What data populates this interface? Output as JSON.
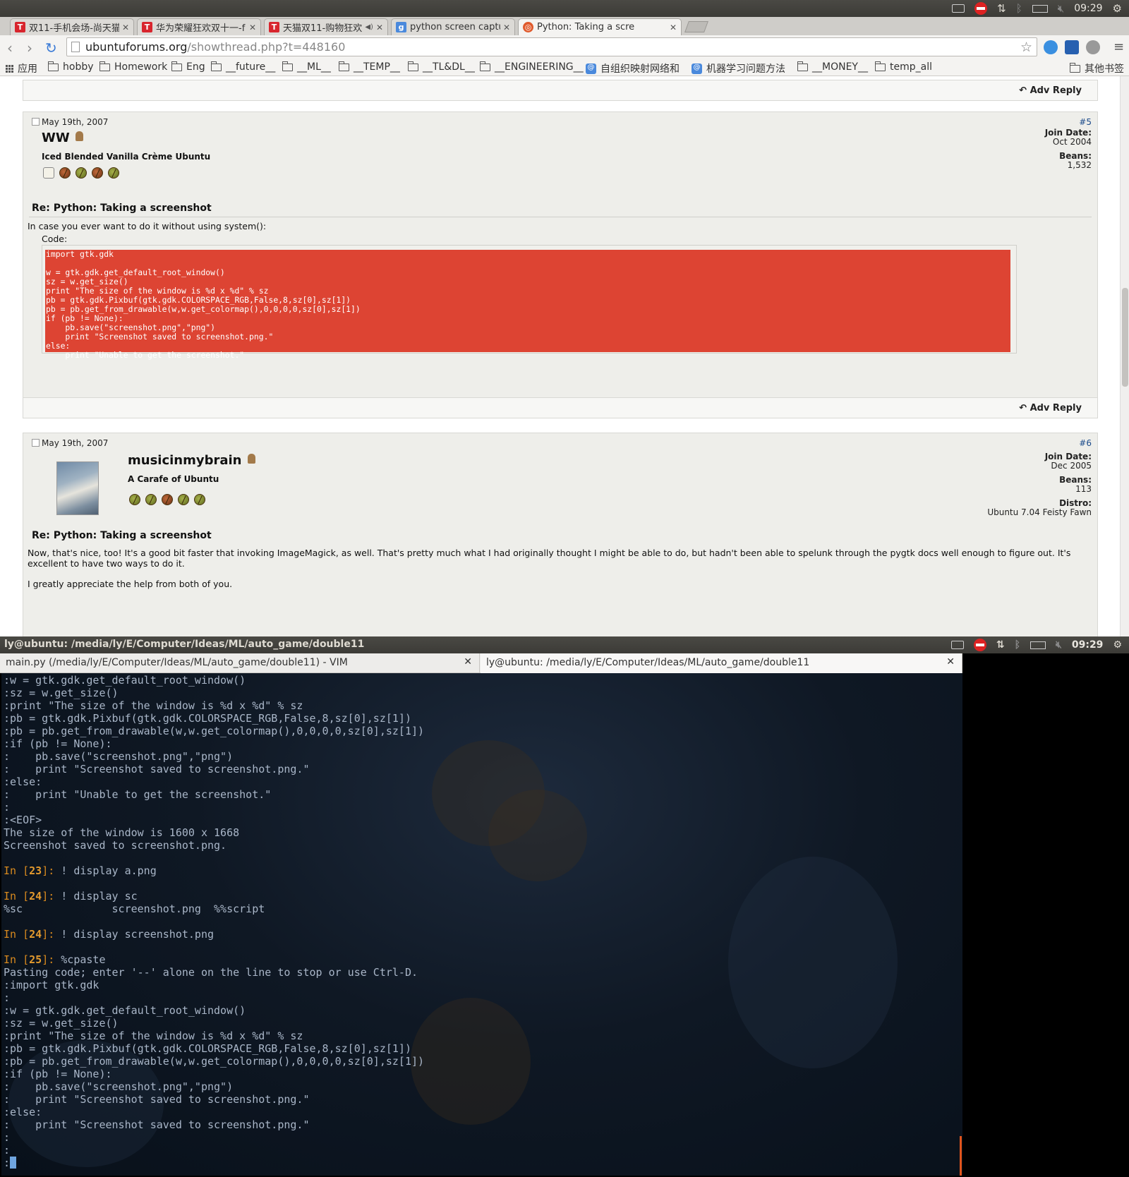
{
  "system": {
    "time": "09:29",
    "tray_icons": [
      "keyboard-icon",
      "no-entry-icon",
      "network-icon",
      "bluetooth-icon",
      "battery-icon",
      "volume-muted-icon",
      "settings-gear-icon"
    ]
  },
  "browser": {
    "tabs": [
      {
        "label": "双11-手机会场-尚天猫",
        "favicon": "T",
        "active": false
      },
      {
        "label": "华为荣耀狂欢双十一-f",
        "favicon": "T",
        "active": false
      },
      {
        "label": "天猫双11-购物狂欢",
        "favicon": "T",
        "active": false,
        "audio": true
      },
      {
        "label": "python screen captur",
        "favicon": "g",
        "active": false
      },
      {
        "label": "Python: Taking a scre",
        "favicon": "u",
        "active": true
      }
    ],
    "url_host": "ubuntuforums.org",
    "url_path": "/showthread.php?t=448160",
    "bookmarks": [
      "应用",
      "hobby",
      "Homework",
      "Eng",
      "__future__",
      "__ML__",
      "__TEMP__",
      "__TL&DL__",
      "__ENGINEERING__",
      "自组织映射网络和",
      "机器学习问题方法",
      "__MONEY__",
      "temp_all"
    ],
    "other_bookmarks": "其他书签"
  },
  "forum": {
    "adv_reply": "Adv Reply",
    "post5": {
      "date": "May 19th, 2007",
      "number": "#5",
      "username": "WW",
      "user_title": "Iced Blended Vanilla Crème Ubuntu",
      "join_label": "Join Date:",
      "join_value": "Oct 2004",
      "beans_label": "Beans:",
      "beans_value": "1,532",
      "title": "Re: Python: Taking a screenshot",
      "intro": "In case you ever want to do it without using system():",
      "code_label": "Code:",
      "code": "import gtk.gdk\n\nw = gtk.gdk.get_default_root_window()\nsz = w.get_size()\nprint \"The size of the window is %d x %d\" % sz\npb = gtk.gdk.Pixbuf(gtk.gdk.COLORSPACE_RGB,False,8,sz[0],sz[1])\npb = pb.get_from_drawable(w,w.get_colormap(),0,0,0,0,sz[0],sz[1])\nif (pb != None):\n    pb.save(\"screenshot.png\",\"png\")\n    print \"Screenshot saved to screenshot.png.\"\nelse:\n    print \"Unable to get the screenshot.\""
    },
    "post6": {
      "date": "May 19th, 2007",
      "number": "#6",
      "username": "musicinmybrain",
      "user_title": "A Carafe of Ubuntu",
      "join_label": "Join Date:",
      "join_value": "Dec 2005",
      "beans_label": "Beans:",
      "beans_value": "113",
      "distro_label": "Distro:",
      "distro_value": "Ubuntu 7.04 Feisty Fawn",
      "title": "Re: Python: Taking a screenshot",
      "body1": "Now, that's nice, too! It's a good bit faster that invoking ImageMagick, as well. That's pretty much what I had originally thought I might be able to do, but hadn't been able to spelunk through the pygtk docs well enough to figure out. It's excellent to have two ways to do it.",
      "body2": "I greatly appreciate the help from both of you."
    }
  },
  "terminal": {
    "window_title": "ly@ubuntu: /media/ly/E/Computer/Ideas/ML/auto_game/double11",
    "tabs": [
      {
        "label": "main.py (/media/ly/E/Computer/Ideas/ML/auto_game/double11) - VIM"
      },
      {
        "label": "ly@ubuntu: /media/ly/E/Computer/Ideas/ML/auto_game/double11"
      }
    ],
    "lines": [
      ":w = gtk.gdk.get_default_root_window()",
      ":sz = w.get_size()",
      ":print \"The size of the window is %d x %d\" % sz",
      ":pb = gtk.gdk.Pixbuf(gtk.gdk.COLORSPACE_RGB,False,8,sz[0],sz[1])",
      ":pb = pb.get_from_drawable(w,w.get_colormap(),0,0,0,0,sz[0],sz[1])",
      ":if (pb != None):",
      ":    pb.save(\"screenshot.png\",\"png\")",
      ":    print \"Screenshot saved to screenshot.png.\"",
      ":else:",
      ":    print \"Unable to get the screenshot.\"",
      ":",
      ":<EOF>",
      "The size of the window is 1600 x 1668",
      "Screenshot saved to screenshot.png.",
      "",
      "In [23]: ! display a.png",
      "",
      "In [24]: ! display sc",
      "%sc              screenshot.png  %%script",
      "",
      "In [24]: ! display screenshot.png",
      "",
      "In [25]: %cpaste",
      "Pasting code; enter '--' alone on the line to stop or use Ctrl-D.",
      ":import gtk.gdk",
      ":",
      ":w = gtk.gdk.get_default_root_window()",
      ":sz = w.get_size()",
      ":print \"The size of the window is %d x %d\" % sz",
      ":pb = gtk.gdk.Pixbuf(gtk.gdk.COLORSPACE_RGB,False,8,sz[0],sz[1])",
      ":pb = pb.get_from_drawable(w,w.get_colormap(),0,0,0,0,sz[0],sz[1])",
      ":if (pb != None):",
      ":    pb.save(\"screenshot.png\",\"png\")",
      ":    print \"Screenshot saved to screenshot.png.\"",
      ":else:",
      ":    print \"Screenshot saved to screenshot.png.\"",
      ":",
      ":",
      ":"
    ]
  }
}
